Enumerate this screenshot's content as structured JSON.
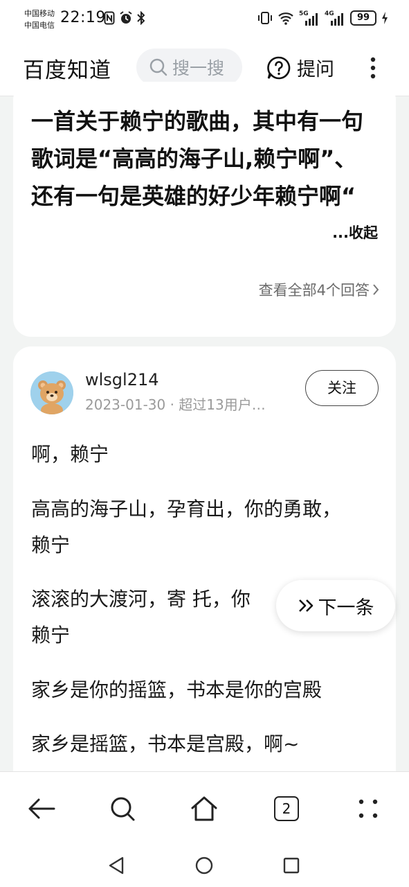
{
  "status_bar": {
    "carrier1": "中国移动",
    "carrier2": "中国电信",
    "time": "22:19",
    "net1": "5G",
    "net2": "4G",
    "battery": "99"
  },
  "header": {
    "logo": "百度知道",
    "search_placeholder": "搜一搜",
    "ask_label": "提问"
  },
  "question": {
    "text": "一首关于赖宁的歌曲，其中有一句歌词是“高高的海子山,赖宁啊”、还有一句是英雄的好少年赖宁啊“",
    "collapse_label": "...收起",
    "view_all_label": "查看全部4个回答"
  },
  "answer": {
    "username": "wlsgl214",
    "meta": "2023-01-30 · 超过13用户…",
    "follow_label": "关注",
    "lines": [
      "啊，赖宁",
      "高高的海子山，孕育出，你的勇敢，",
      "赖宁",
      "滚滚的大渡河，寄 托，你",
      "赖宁",
      "家乡是你的摇篮，书本是你的宫殿",
      "家乡是摇篮，书本是宫殿，啊~"
    ]
  },
  "next_button": {
    "label": "下一条"
  },
  "toolbar": {
    "tab_count": "2"
  },
  "icons": {
    "back": "back-arrow-icon",
    "search": "search-icon",
    "home": "home-icon",
    "tabs": "tabs-icon",
    "more": "more-grid-icon"
  }
}
